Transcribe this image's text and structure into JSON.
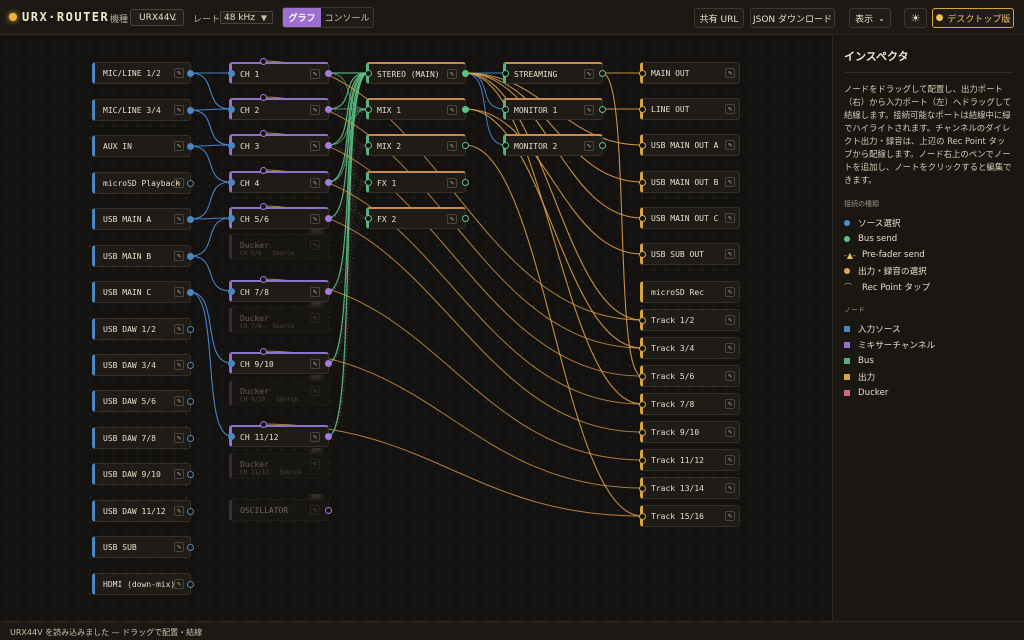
{
  "app": {
    "title": "URX·ROUTER"
  },
  "toolbar": {
    "device_label": "機種",
    "device_value": "URX44V",
    "rate_label": "レート",
    "rate_value": "48 kHz",
    "tab_graph": "グラフ",
    "tab_console": "コンソール",
    "share_url": "共有 URL",
    "json_download": "JSON ダウンロード",
    "view_menu": "表示",
    "desktop_button": "デスクトップ版"
  },
  "inputs": [
    "MIC/LINE 1/2",
    "MIC/LINE 3/4",
    "AUX IN",
    "microSD Playback",
    "USB MAIN A",
    "USB MAIN B",
    "USB MAIN C",
    "USB DAW 1/2",
    "USB DAW 3/4",
    "USB DAW 5/6",
    "USB DAW 7/8",
    "USB DAW 9/10",
    "USB DAW 11/12",
    "USB SUB",
    "HDMI (down-mix)"
  ],
  "channels": [
    "CH 1",
    "CH 2",
    "CH 3",
    "CH 4",
    "CH 5/6",
    "CH 7/8",
    "CH 9/10",
    "CH 11/12"
  ],
  "duckers": [
    {
      "title": "Ducker",
      "sub": "CH 5/6 · Source",
      "badge": "OFF"
    },
    {
      "title": "Ducker",
      "sub": "CH 7/8 · Source",
      "badge": "OFF"
    },
    {
      "title": "Ducker",
      "sub": "CH 9/10 · Source",
      "badge": "OFF"
    },
    {
      "title": "Ducker",
      "sub": "CH 11/12 · Source",
      "badge": "OFF"
    }
  ],
  "oscillator": {
    "label": "OSCILLATOR",
    "badge": "OFF"
  },
  "buses": [
    "STEREO (MAIN)",
    "MIX 1",
    "MIX 2",
    "FX 1",
    "FX 2"
  ],
  "monitors": [
    "STREAMING",
    "MONITOR 1",
    "MONITOR 2"
  ],
  "outputs": [
    "MAIN OUT",
    "LINE OUT",
    "USB MAIN OUT A",
    "USB MAIN OUT B",
    "USB MAIN OUT C",
    "USB SUB OUT"
  ],
  "rec": [
    "microSD Rec",
    "Track 1/2",
    "Track 3/4",
    "Track 5/6",
    "Track 7/8",
    "Track 9/10",
    "Track 11/12",
    "Track 13/14",
    "Track 15/16"
  ],
  "inspector": {
    "title": "インスペクタ",
    "description": "ノードをドラッグして配置し、出力ポート（右）から入力ポート（左）へドラッグして結線します。接続可能なポートは結線中に緑でハイライトされます。チャンネルのダイレクト出力・録音は、上辺の Rec Point タップから配線します。ノード右上のペンでノートを追加し、ノートをクリックすると編集できます。",
    "conn_heading": "接続の種類",
    "conn_types": [
      {
        "label": "ソース選択",
        "color": "#4a90d9"
      },
      {
        "label": "Bus send",
        "color": "#5cc184"
      },
      {
        "label": "Pre-fader send",
        "color": "#e3c766"
      },
      {
        "label": "出力・録音の選択",
        "color": "#e2a64a"
      },
      {
        "label": "Rec Point タップ",
        "color": "#d9a441"
      }
    ],
    "node_heading": "ノード",
    "node_types": [
      {
        "label": "入力ソース",
        "color": "#4a86c0"
      },
      {
        "label": "ミキサーチャンネル",
        "color": "#9a6ed0"
      },
      {
        "label": "Bus",
        "color": "#58b07a"
      },
      {
        "label": "出力",
        "color": "#d9a441"
      },
      {
        "label": "Ducker",
        "color": "#d0628a"
      }
    ]
  },
  "status": "URX44V を読み込みました — ドラッグで配置・結線"
}
